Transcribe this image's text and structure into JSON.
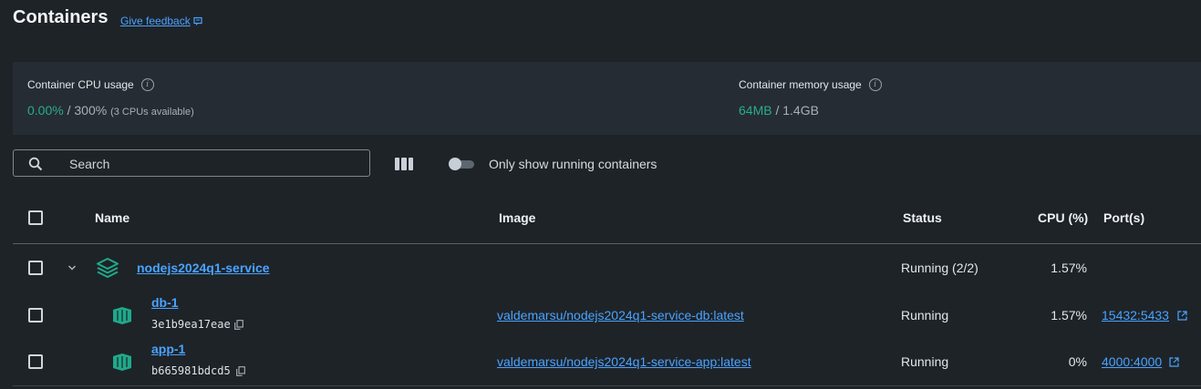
{
  "page": {
    "title": "Containers",
    "feedback_link": "Give feedback"
  },
  "stats": {
    "cpu_label": "Container CPU usage",
    "cpu_used": "0.00%",
    "cpu_sep": " / ",
    "cpu_total": "300%",
    "cpu_note": "(3 CPUs available)",
    "mem_label": "Container memory usage",
    "mem_used": "64MB",
    "mem_sep": " / ",
    "mem_total": "1.4GB"
  },
  "toolbar": {
    "search_placeholder": "Search",
    "toggle_label": "Only show running containers",
    "toggle_on": false
  },
  "table": {
    "headers": [
      "Name",
      "Image",
      "Status",
      "CPU (%)",
      "Port(s)"
    ],
    "group": {
      "name": "nodejs2024q1-service",
      "status": "Running (2/2)",
      "cpu": "1.57%"
    },
    "rows": [
      {
        "name": "db-1",
        "id": "3e1b9ea17eae",
        "image": "valdemarsu/nodejs2024q1-service-db:latest",
        "status": "Running",
        "cpu": "1.57%",
        "ports": "15432:5433"
      },
      {
        "name": "app-1",
        "id": "b665981bdcd5",
        "image": "valdemarsu/nodejs2024q1-service-app:latest",
        "status": "Running",
        "cpu": "0%",
        "ports": "4000:4000"
      }
    ]
  },
  "colors": {
    "accent_green": "#27ad90",
    "link_blue": "#4aa3ff",
    "background": "#1e2328"
  },
  "icons": [
    "feedback-icon",
    "info-icon",
    "search-icon",
    "columns-icon",
    "chevron-down-icon",
    "compose-stack-icon",
    "container-icon",
    "copy-icon",
    "external-link-icon"
  ]
}
